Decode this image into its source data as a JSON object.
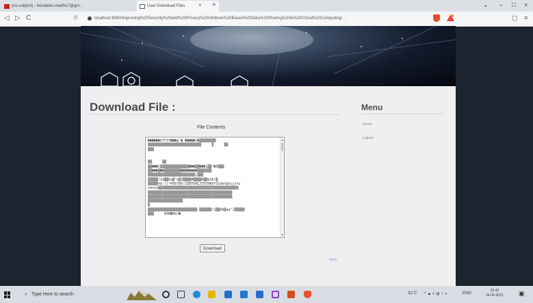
{
  "browser": {
    "tabs": [
      {
        "label": "(no subject) - bondaleo.madhu7@gm..."
      },
      {
        "label": "User Download Files"
      }
    ],
    "new_tab": "+",
    "close_tab": "×",
    "window_controls": {
      "minimize": "–",
      "maximize": "□",
      "close": "×"
    },
    "nav": {
      "back": "◁",
      "forward": "▷",
      "reload": "C",
      "bookmark": "⌑"
    },
    "url": "localhost:8080/Improving%20Security%20and%20Privacy%20Attribute%20Based%20Data%20Sharing%20in%20Cloud%20Computing/..."
  },
  "page": {
    "title": "Download File :",
    "file_contents_label": "File Contents",
    "file_contents_lines": [
      "������07F1F���@`�`�����C�▒▒▒▒▒▒▒▒",
      "▒▒▒▒▒▒▒▒▒▒▒▒▒▒▒▒▒▒▒▒▒▒▒▒▒▒     ▒     ▒▒",
      "▒▒▒",
      "",
      "",
      "▒▒     ▒▒",
      "▒▒���C▒▒▒▒▒▒▒▒▒▒▒▒▒▒���▒▒���1▒▒\"�0▒▒▒",
      "▒▒���▒��▒▒▒▒▒▒▒▒��������▒▒▒▒▒▒▒",
      "▒▒▒▒▒▒▒▒▒▒▒▒▒▒▒▒▒▒▒▒▒▒▒|▒▒▒",
      "▒▒▒▒▒!1A▒▒Qa▒\"q▒2▒▒▒▒#▒▒▒▒R▒▒$3br▒",
      "▒▒▒▒▒%&'()*456789:CDEFGHIJSTUVWXYZcdefghijstu",
      "vwxyz▒▒▒▒▒▒▒▒▒▒▒▒▒▒▒▒▒▒▒▒▒▒▒▒▒▒▒▒▒▒▒▒▒▒▒▒▒▒▒",
      "▒▒▒▒▒▒▒▒▒▒▒▒▒▒▒▒▒▒▒▒▒▒▒▒▒▒▒▒▒▒▒▒▒▒▒▒▒▒▒▒▒",
      "▒▒▒▒▒▒▒▒▒▒▒▒▒▒▒▒▒▒▒▒▒▒▒▒▒▒▒▒▒▒▒▒▒▒▒▒▒▒▒▒▒",
      "▒▒▒▒▒▒▒▒▒▒▒▒▒▒▒▒▒",
      "▒",
      "▒▒▒▒▒▒▒▒▒▒▒▒▒▒▒▒▒▒▒▒▒▒▒▒-▒▒▒▒▒▒!1▒▒AQ▒aq\"/▒▒▒▒▒",
      "▒▒▒     #3R�0br�"
    ],
    "download_button": "Download",
    "back_link": "Back"
  },
  "menu": {
    "title": "Menu",
    "items": [
      {
        "label": "Home"
      },
      {
        "label": "Logout"
      }
    ]
  },
  "taskbar": {
    "search_placeholder": "Type here to search",
    "weather": "31°C",
    "language": "ENG",
    "time": "23:43",
    "date": "26-06-2022"
  },
  "colors": {
    "page_background": "#1c2430",
    "panel": "#efefef",
    "link": "#6fa0d8",
    "heading": "#4a4a4a"
  }
}
